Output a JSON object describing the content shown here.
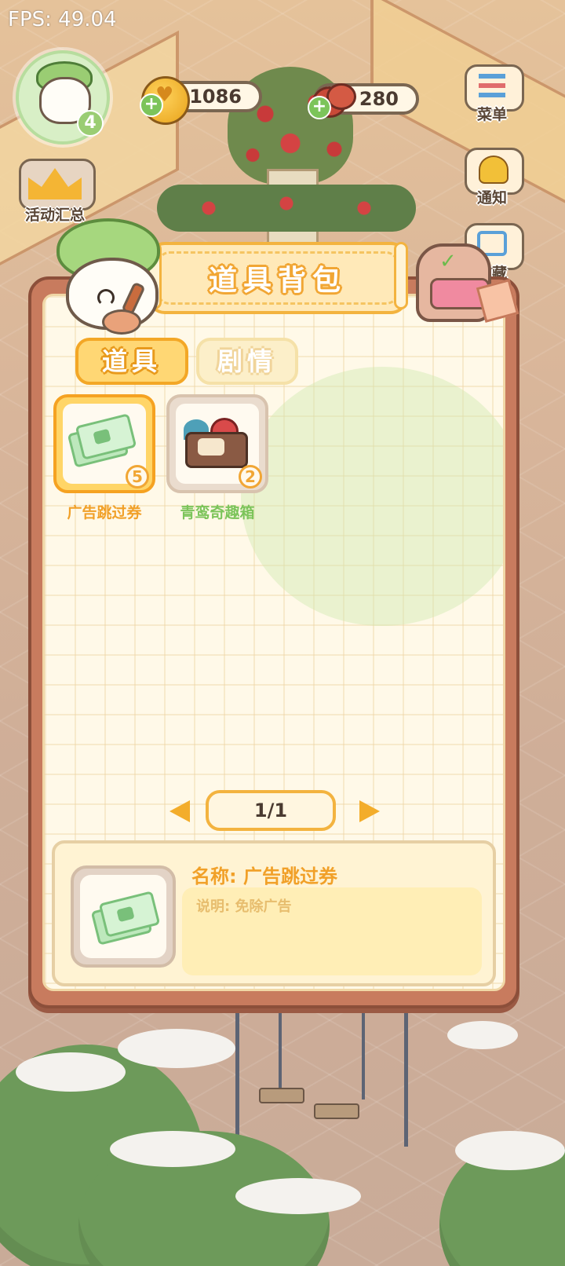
{
  "fps": "FPS: 49.04",
  "player": {
    "level": "4"
  },
  "currency": {
    "coins": "1086",
    "radish": "280"
  },
  "side_buttons": {
    "activity": "活动汇总",
    "menu": "菜单",
    "notify": "通知",
    "hide": "隐藏"
  },
  "modal": {
    "title": "道具背包",
    "tabs": [
      {
        "label": "道具",
        "active": true
      },
      {
        "label": "剧情",
        "active": false
      }
    ],
    "items": [
      {
        "name": "广告跳过券",
        "count": "5",
        "icon": "ad-skip-ticket-icon",
        "selected": true
      },
      {
        "name": "青鸾奇趣箱",
        "count": "2",
        "icon": "treasure-chest-icon",
        "selected": false
      }
    ],
    "page": "1/1",
    "detail": {
      "name": "名称: 广告跳过券",
      "description": "说明: 免除广告"
    }
  },
  "colors": {
    "accent": "#f3a726",
    "item_name_selected": "#f1a028",
    "item_name_normal": "#7cc45a",
    "frame": "#c87b5e"
  }
}
